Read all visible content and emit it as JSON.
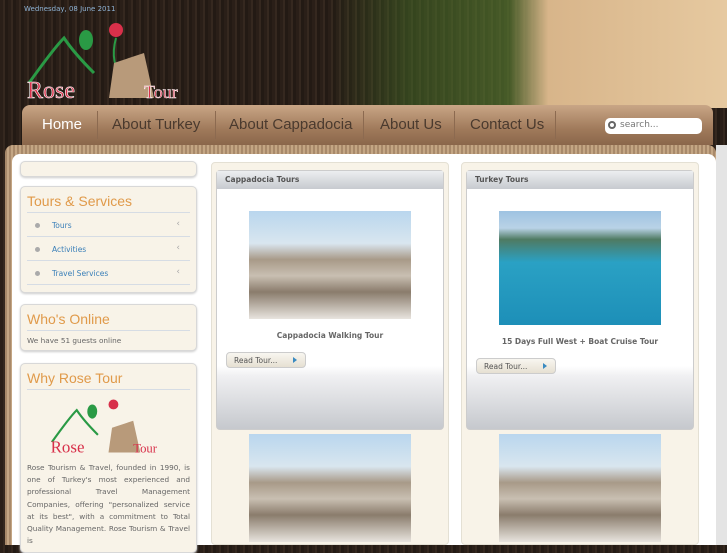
{
  "header": {
    "date": "Wednesday, 08 June 2011",
    "logo_text": "Rose Tour"
  },
  "nav": {
    "items": [
      "Home",
      "About Turkey",
      "About Cappadocia",
      "About Us",
      "Contact Us"
    ]
  },
  "search": {
    "placeholder": "search..."
  },
  "sidebar": {
    "tours_services": {
      "title": "Tours & Services",
      "items": [
        "Tours",
        "Activities",
        "Travel Services"
      ]
    },
    "whos_online": {
      "title": "Who's Online",
      "text": "We have 51 guests online"
    },
    "why": {
      "title": "Why Rose Tour",
      "logo_text": "Rose Tour",
      "text": "Rose Tourism & Travel, founded in 1990, is one of Turkey's most experienced and professional Travel Management Companies, offering \"personalized service at its best\", with a commitment to Total Quality Management. Rose Tourism & Travel is"
    }
  },
  "columns": [
    {
      "title": "Cappadocia Tours",
      "caption": "Cappadocia Walking Tour",
      "button": "Read Tour..."
    },
    {
      "title": "Turkey Tours",
      "caption": "15 Days Full West + Boat Cruise Tour",
      "button": "Read Tour..."
    }
  ]
}
